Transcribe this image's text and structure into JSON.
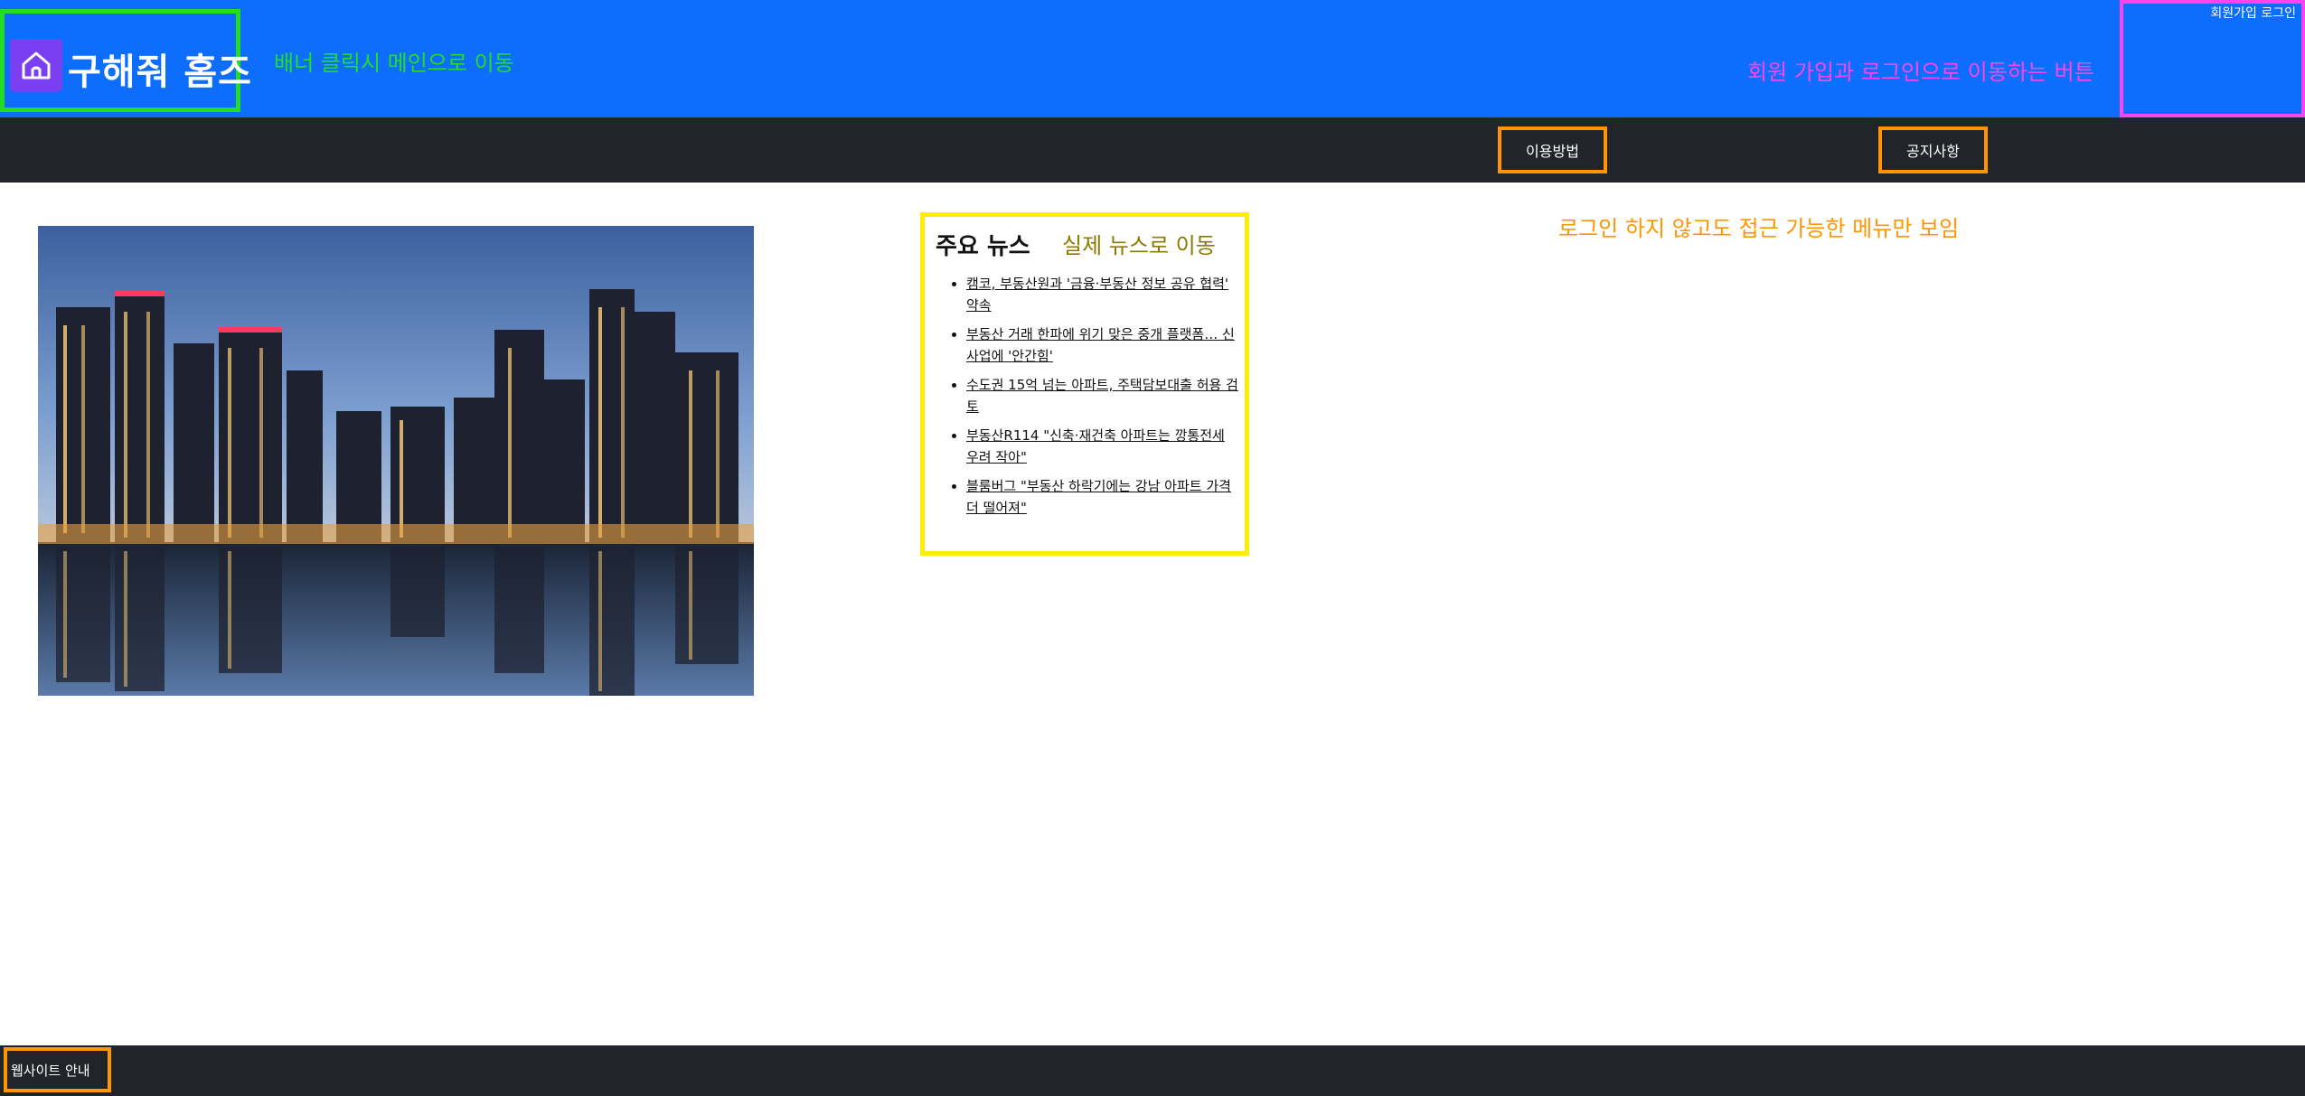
{
  "header": {
    "logo_icon": "home-icon",
    "logo_title": "구해줘 홈즈",
    "banner_annotation": "배너 클릭시 메인으로 이동",
    "member_annotation": "회원 가입과 로그인으로 이동하는 버튼",
    "signup_label": "회원가입",
    "login_label": "로그인"
  },
  "nav": {
    "items": [
      {
        "label": "이용방법"
      },
      {
        "label": "공지사항"
      }
    ],
    "annotation": "로그인 하지 않고도 접근 가능한 메뉴만 보임"
  },
  "news": {
    "title": "주요 뉴스",
    "annotation": "실제 뉴스로 이동",
    "items": [
      {
        "text": "캠코, 부동산원과 '금융·부동산 정보 공유 협력' 약속"
      },
      {
        "text": "부동산 거래 한파에 위기 맞은 중개 플랫폼… 신사업에 '안간힘'"
      },
      {
        "text": "수도권 15억 넘는 아파트, 주택담보대출 허용 검토"
      },
      {
        "text": "부동산R114 \"신축·재건축 아파트는 깡통전세 우려 작아\""
      },
      {
        "text": "블룸버그 \"부동산 하락기에는 강남 아파트 가격 더 떨어져\""
      }
    ]
  },
  "footer": {
    "link_label": "웹사이트 안내"
  },
  "colors": {
    "header_bg": "#0d6efd",
    "nav_bg": "#212529",
    "banner_annotation": "#22dd22",
    "member_annotation": "#ff44ee",
    "nav_annotation": "#ff9500",
    "news_border": "#ffee00"
  }
}
